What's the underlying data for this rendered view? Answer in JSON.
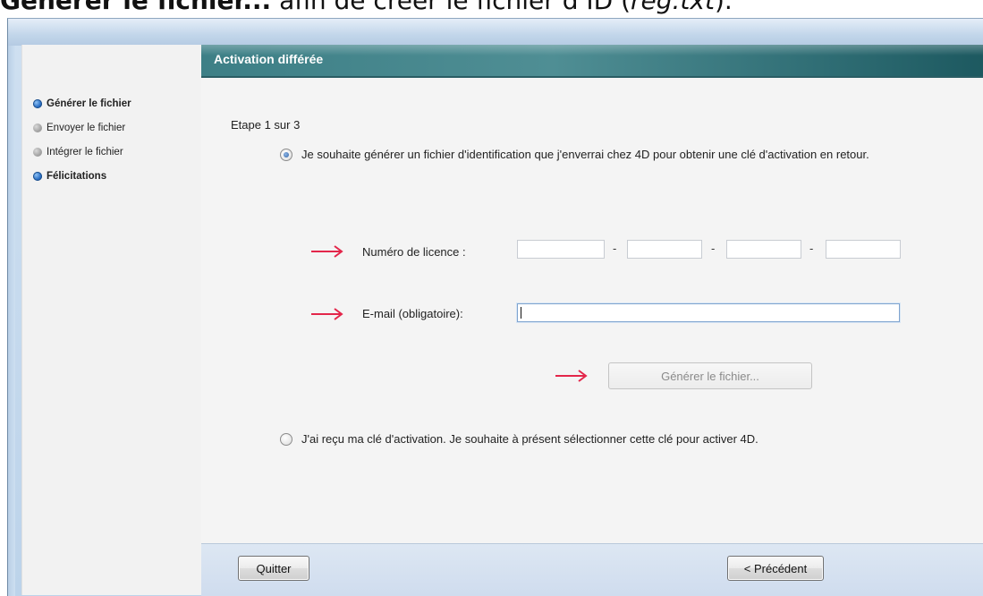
{
  "doc_heading": {
    "bold_part": "Générer le fichier...",
    "normal_part": " afin de créer le fichier d’ID (",
    "italic_part": "reg.txt",
    "end_part": ")."
  },
  "sidebar": {
    "steps": [
      {
        "label": "Générer le fichier",
        "state": "current"
      },
      {
        "label": "Envoyer le fichier",
        "state": "pending"
      },
      {
        "label": "Intégrer le fichier",
        "state": "pending"
      },
      {
        "label": "Félicitations",
        "state": "current"
      }
    ]
  },
  "panel": {
    "title": "Activation différée",
    "step_count": "Etape 1 sur 3",
    "option_generate": {
      "text": "Je souhaite générer un fichier d'identification que j'enverrai chez 4D pour obtenir une clé d'activation en retour.",
      "selected": true
    },
    "license_label": "Numéro de licence :",
    "license_separators": [
      "-",
      "-",
      "-"
    ],
    "email_label": "E-mail (obligatoire):",
    "generate_button": "Générer le fichier...",
    "option_received": {
      "text": "J'ai reçu ma clé d'activation. Je souhaite à présent sélectionner cette clé pour activer 4D.",
      "selected": false
    }
  },
  "footer": {
    "quit_label": "Quitter",
    "previous_label": "< Précédent"
  },
  "colors": {
    "header_teal": "#3d7f86",
    "arrow_red": "#e3264a",
    "sidebar_bg": "#f2f2f2"
  }
}
